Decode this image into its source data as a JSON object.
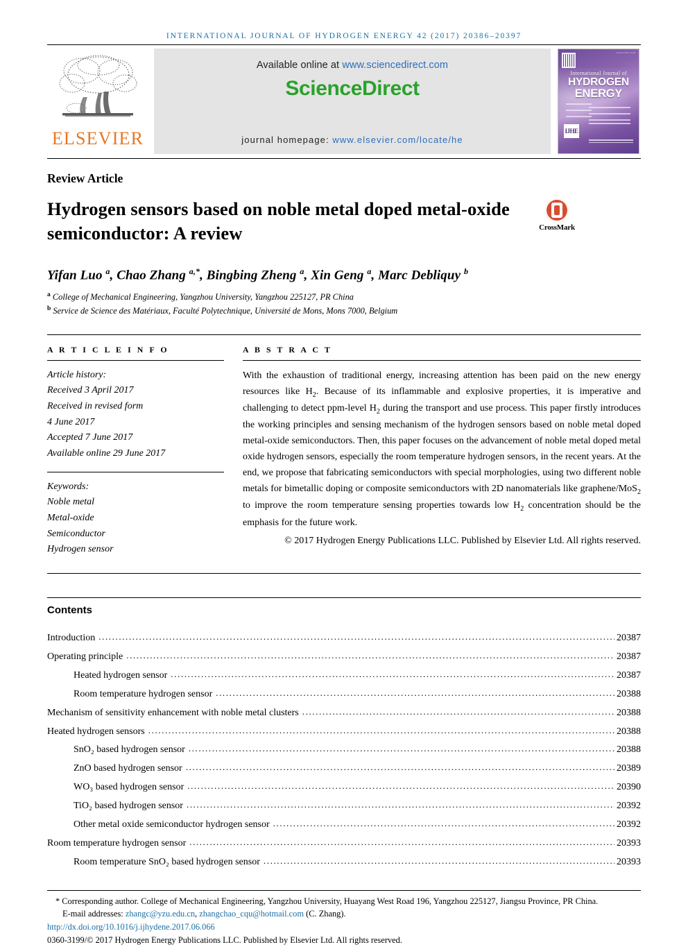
{
  "running_head": "INTERNATIONAL JOURNAL OF HYDROGEN ENERGY 42 (2017) 20386–20397",
  "masthead": {
    "publisher": "ELSEVIER",
    "available_prefix": "Available online at ",
    "available_url": "www.sciencedirect.com",
    "sciencedirect_logo": "ScienceDirect",
    "homepage_prefix": "journal homepage: ",
    "homepage_url": "www.elsevier.com/locate/he",
    "cover": {
      "issn_line": "ISSN 0360-3199",
      "line1": "International Journal of",
      "line2": "HYDROGEN",
      "line3": "ENERGY",
      "badge": "IJHE",
      "imprint": "ScienceDirect"
    }
  },
  "article": {
    "type": "Review Article",
    "title": "Hydrogen sensors based on noble metal doped metal-oxide semiconductor: A review",
    "crossmark_label": "CrossMark",
    "authors_html": "Yifan Luo <sup>a</sup>, Chao Zhang <sup>a,*</sup>, Bingbing Zheng <sup>a</sup>, Xin Geng <sup>a</sup>, Marc Debliquy <sup>b</sup>",
    "affiliation_a": "College of Mechanical Engineering, Yangzhou University, Yangzhou 225127, PR China",
    "affiliation_b": "Service de Science des Matériaux, Faculté Polytechnique, Université de Mons, Mons 7000, Belgium"
  },
  "article_info": {
    "heading": "A R T I C L E   I N F O",
    "history_label": "Article history:",
    "received": "Received 3 April 2017",
    "revised_label": "Received in revised form",
    "revised_date": "4 June 2017",
    "accepted": "Accepted 7 June 2017",
    "available_online": "Available online 29 June 2017",
    "keywords_label": "Keywords:",
    "keywords": [
      "Noble metal",
      "Metal-oxide",
      "Semiconductor",
      "Hydrogen sensor"
    ]
  },
  "abstract": {
    "heading": "A B S T R A C T",
    "body_html": "With the exhaustion of traditional energy, increasing attention has been paid on the new energy resources like H<sub>2</sub>. Because of its inflammable and explosive properties, it is imperative and challenging to detect ppm-level H<sub>2</sub> during the transport and use process. This paper firstly introduces the working principles and sensing mechanism of the hydrogen sensors based on noble metal doped metal-oxide semiconductors. Then, this paper focuses on the advancement of noble metal doped metal oxide hydrogen sensors, especially the room temperature hydrogen sensors, in the recent years. At the end, we propose that fabricating semiconductors with special morphologies, using two different noble metals for bimetallic doping or composite semiconductors with 2D nanomaterials like graphene/MoS<sub>2</sub> to improve the room temperature sensing properties towards low H<sub>2</sub> concentration should be the emphasis for the future work.",
    "copyright": "© 2017 Hydrogen Energy Publications LLC. Published by Elsevier Ltd. All rights reserved."
  },
  "contents": {
    "heading": "Contents",
    "entries": [
      {
        "label": "Introduction",
        "page": "20387",
        "indent": false
      },
      {
        "label": "Operating principle",
        "page": "20387",
        "indent": false
      },
      {
        "label": "Heated hydrogen sensor",
        "page": "20387",
        "indent": true
      },
      {
        "label": "Room temperature hydrogen sensor",
        "page": "20388",
        "indent": true
      },
      {
        "label": "Mechanism of sensitivity enhancement with noble metal clusters",
        "page": "20388",
        "indent": false
      },
      {
        "label": "Heated hydrogen sensors",
        "page": "20388",
        "indent": false
      },
      {
        "label": "SnO₂ based hydrogen sensor",
        "page": "20388",
        "indent": true
      },
      {
        "label": "ZnO based hydrogen sensor",
        "page": "20389",
        "indent": true
      },
      {
        "label": "WO₃ based hydrogen sensor",
        "page": "20390",
        "indent": true
      },
      {
        "label": "TiO₂ based hydrogen sensor",
        "page": "20392",
        "indent": true
      },
      {
        "label": "Other metal oxide semiconductor hydrogen sensor",
        "page": "20392",
        "indent": true
      },
      {
        "label": "Room temperature hydrogen sensor",
        "page": "20393",
        "indent": false
      },
      {
        "label": "Room temperature SnO₂ based hydrogen sensor",
        "page": "20393",
        "indent": true
      }
    ]
  },
  "footer": {
    "corresponding": "* Corresponding author. College of Mechanical Engineering, Yangzhou University, Huayang West Road 196, Yangzhou 225127, Jiangsu Province, PR China.",
    "email_label": "E-mail addresses:",
    "email1": "zhangc@yzu.edu.cn",
    "email2": "zhangchao_cqu@hotmail.com",
    "email_suffix": "(C. Zhang).",
    "doi": "http://dx.doi.org/10.1016/j.ijhydene.2017.06.066",
    "issn_line": "0360-3199/© 2017 Hydrogen Energy Publications LLC. Published by Elsevier Ltd. All rights reserved."
  },
  "colors": {
    "link": "#1a6fa3",
    "elsevier_orange": "#e87722",
    "sciencedirect_green": "#2aa22a",
    "crossmark_red": "#d64e32"
  }
}
